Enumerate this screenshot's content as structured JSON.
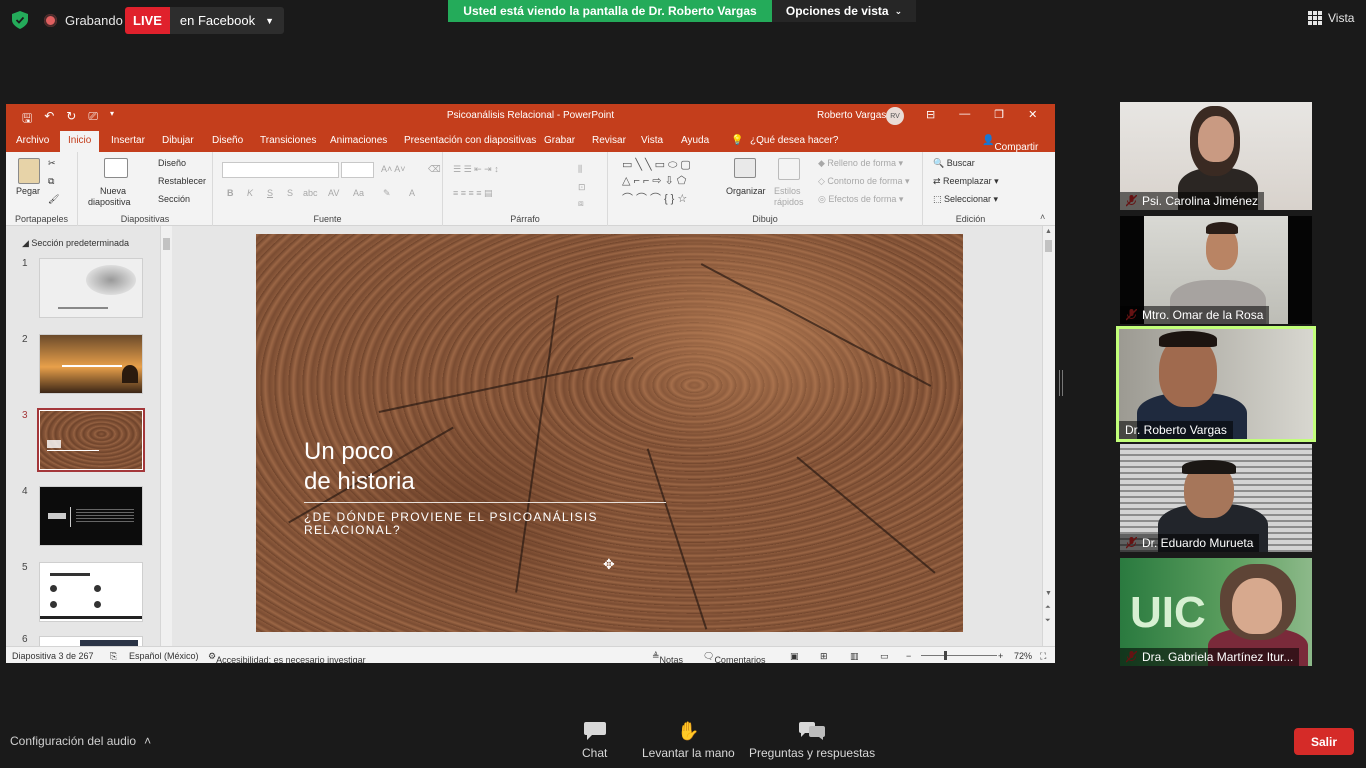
{
  "zoom": {
    "recording_label": "Grabando",
    "live_label": "LIVE",
    "live_destination": "en Facebook",
    "share_banner": "Usted está viendo la pantalla de Dr. Roberto Vargas",
    "view_options": "Opciones de vista",
    "view_label": "Vista",
    "audio_settings": "Configuración del audio",
    "chat": "Chat",
    "raise_hand": "Levantar la mano",
    "qa": "Preguntas y respuestas",
    "leave": "Salir",
    "accent_green": "#24ab5a",
    "live_red": "#e0212c",
    "active_speaker_border": "#c2ff7a"
  },
  "participants": [
    {
      "name": "Psi. Carolina Jiménez",
      "muted": true
    },
    {
      "name": "Mtro. Omar de la Rosa",
      "muted": true
    },
    {
      "name": "Dr. Roberto Vargas",
      "muted": false,
      "active": true
    },
    {
      "name": "Dr. Eduardo Murueta",
      "muted": true
    },
    {
      "name": "Dra. Gabriela Martínez Itur...",
      "muted": true
    }
  ],
  "ppt": {
    "title": "Psicoanálisis Relacional - PowerPoint",
    "user": "Roberto Vargas",
    "user_initials": "RV",
    "brand_color": "#c43e1c",
    "menu": [
      "Archivo",
      "Inicio",
      "Insertar",
      "Dibujar",
      "Diseño",
      "Transiciones",
      "Animaciones",
      "Presentación con diapositivas",
      "Grabar",
      "Revisar",
      "Vista",
      "Ayuda"
    ],
    "tell_me": "¿Qué desea hacer?",
    "share": "Compartir",
    "ribbon": {
      "paste": "Pegar",
      "new_slide": "Nueva",
      "new_slide2": "diapositiva",
      "layout": "Diseño",
      "reset": "Restablecer",
      "section": "Sección",
      "arrange": "Organizar",
      "quick_styles": "Estilos",
      "quick_styles2": "rápidos",
      "shape_fill": "Relleno de forma",
      "shape_outline": "Contorno de forma",
      "shape_effects": "Efectos de forma",
      "find": "Buscar",
      "replace": "Reemplazar",
      "select": "Seleccionar",
      "groups": [
        "Portapapeles",
        "Diapositivas",
        "Fuente",
        "Párrafo",
        "Dibujo",
        "Edición"
      ]
    },
    "section_name": "Sección predeterminada",
    "slide_numbers": [
      "1",
      "2",
      "3",
      "4",
      "5",
      "6"
    ],
    "slide": {
      "title_line1": "Un poco",
      "title_line2": "de historia",
      "subtitle": "¿DE DÓNDE PROVIENE EL PSICOANÁLISIS RELACIONAL?"
    },
    "status": {
      "slide_count": "Diapositiva 3 de 267",
      "language": "Español (México)",
      "accessibility": "Accesibilidad: es necesario investigar",
      "notes": "Notas",
      "comments": "Comentarios",
      "zoom": "72%"
    }
  }
}
